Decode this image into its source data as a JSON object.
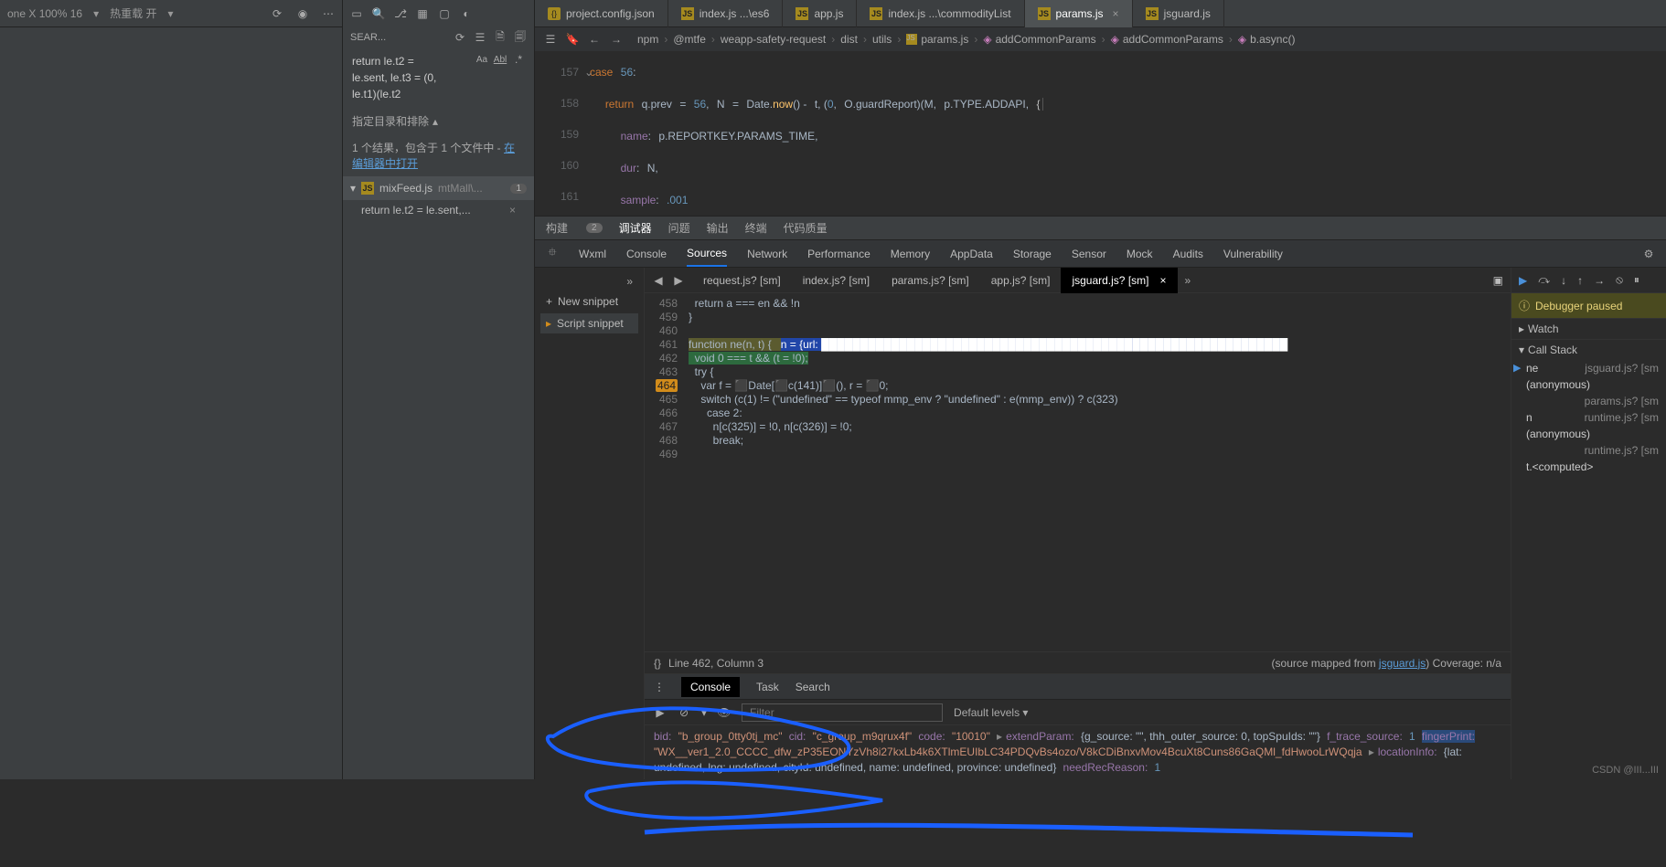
{
  "topbar": {
    "device": "one X 100% 16",
    "hotreload": "热重载 开"
  },
  "search": {
    "label": "SEAR...",
    "query_l1": "return le.t2 =",
    "query_l2": "le.sent, le.t3 = (0,",
    "query_l3": "le.t1)(le.t2",
    "scope": "指定目录和排除",
    "results_prefix": "1 个结果，包含于 1 个文件中 - ",
    "results_link": "在编辑器中打开",
    "file_name": "mixFeed.js",
    "file_path": "mtMall\\...",
    "file_count": "1",
    "match_text": "return le.t2 = le.sent,..."
  },
  "tabs": [
    {
      "icon": "json",
      "label": "project.config.json"
    },
    {
      "icon": "js",
      "label": "index.js ...\\es6"
    },
    {
      "icon": "js",
      "label": "app.js"
    },
    {
      "icon": "js",
      "label": "index.js ...\\commodityList"
    },
    {
      "icon": "js",
      "label": "params.js",
      "active": true,
      "close": true
    },
    {
      "icon": "js",
      "label": "jsguard.js"
    }
  ],
  "breadcrumb": [
    "npm",
    "@mtfe",
    "weapp-safety-request",
    "dist",
    "utils",
    "params.js",
    "addCommonParams",
    "addCommonParams",
    "b.async()"
  ],
  "code": {
    "lines": [
      "157",
      "158",
      "159",
      "160",
      "161"
    ],
    "l157": "case 56:",
    "l158": "return q.prev = 56, N = Date.now() - t, (0, O.guardReport)(M, p.TYPE.ADDAPI, {",
    "l159": "name: p.REPORTKEY.PARAMS_TIME,",
    "l160": "dur: N,",
    "l161": "sample: .001"
  },
  "dt": {
    "tabs1": [
      "构建",
      "调试器",
      "问题",
      "输出",
      "终端",
      "代码质量"
    ],
    "tabs1_count": "2",
    "tabs2": [
      "Wxml",
      "Console",
      "Sources",
      "Network",
      "Performance",
      "Memory",
      "AppData",
      "Storage",
      "Sensor",
      "Mock",
      "Audits",
      "Vulnerability"
    ],
    "newsnippet": "New snippet",
    "scriptsnippet": "Script snippet",
    "sourcetabs": [
      "request.js? [sm]",
      "index.js? [sm]",
      "params.js? [sm]",
      "app.js? [sm]",
      "jsguard.js? [sm]"
    ],
    "src_gutter": [
      "458",
      "459",
      "460",
      "461",
      "462",
      "463",
      "464",
      "465",
      "466",
      "467",
      "468",
      "469"
    ],
    "src": {
      "l458": "  return a === en && !n",
      "l459": "}",
      "l460": "",
      "l461_a": "function ne(n, t) {   ",
      "l461_b": "n = {url: ",
      "l462": "  void 0 === t && (t = !0);",
      "l463": "  try {",
      "l464": "    var f = ⬛Date[⬛c(141)]⬛(), r = ⬛0;",
      "l465": "    switch (c(1) != (\"undefined\" == typeof mmp_env ? \"undefined\" : e(mmp_env)) ? c(323)",
      "l466": "      case 2:",
      "l467": "        n[c(325)] = !0, n[c(326)] = !0;",
      "l468": "        break;",
      "l469": ""
    },
    "status_left": "Line 462, Column 3",
    "status_right_a": "(source mapped from ",
    "status_right_link": "jsguard.js",
    "status_right_b": ") Coverage: n/a",
    "paused": "Debugger paused",
    "watch": "Watch",
    "callstack": "Call Stack",
    "stack": [
      {
        "fn": "ne",
        "loc": "jsguard.js? [sm",
        "cur": true
      },
      {
        "fn": "(anonymous)",
        "loc": ""
      },
      {
        "fn": "",
        "loc": "params.js? [sm"
      },
      {
        "fn": "n",
        "loc": "runtime.js? [sm"
      },
      {
        "fn": "(anonymous)",
        "loc": ""
      },
      {
        "fn": "",
        "loc": "runtime.js? [sm"
      },
      {
        "fn": "t.<computed>",
        "loc": ""
      }
    ]
  },
  "console": {
    "tabs": [
      "Console",
      "Task",
      "Search"
    ],
    "filter_ph": "Filter",
    "levels": "Default levels",
    "lines": {
      "bid_k": "bid:",
      "bid_v": "\"b_group_0tty0tj_mc\"",
      "cid_k": "cid:",
      "cid_v": "\"c_group_m9qrux4f\"",
      "code_k": "code:",
      "code_v": "\"10010\"",
      "ep_k": "extendParam:",
      "ep_v": "{g_source: \"\", thh_outer_source: 0, topSpuIds: \"\"}",
      "fts_k": "f_trace_source:",
      "fts_v": "1",
      "fp_k": "fingerPrint:",
      "fp_v": "\"WX__ver1_2.0_CCCC_dfw_zP35EONYzVh8i27kxLb4k6XTlmEUIbLC34PDQvBs4ozo/V8kCDiBnxvMov4BcuXt8Cuns86GaQMl_fdHwooLrWQqja",
      "loc_k": "locationInfo:",
      "loc_v": "{lat: undefined, lng: undefined, cityId: undefined, name: undefined, province: undefined}",
      "nrr_k": "needRecReason:",
      "nrr_v": "1"
    }
  },
  "watermark": "CSDN @III...III"
}
